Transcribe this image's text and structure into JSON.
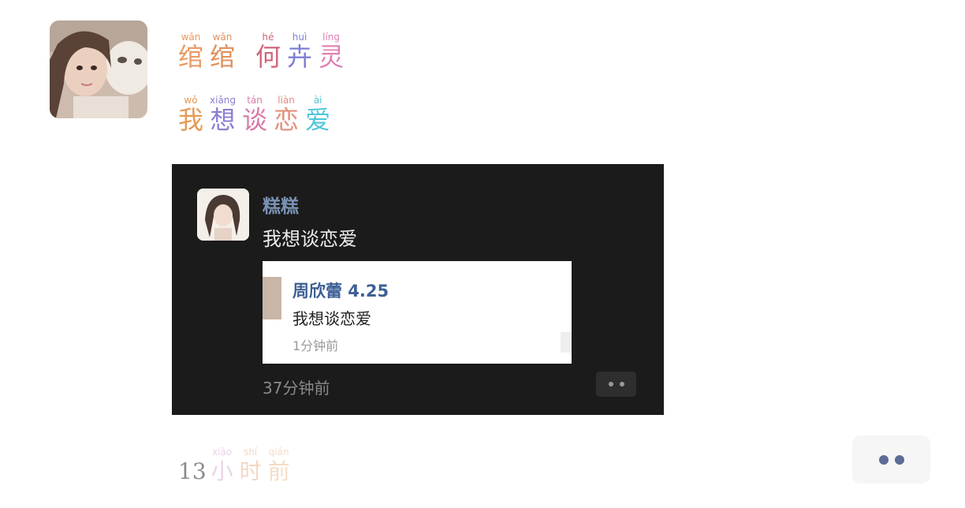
{
  "post": {
    "avatar_icon": "user-avatar-girl-with-cat",
    "line1": [
      {
        "py": "wǎn",
        "hz": "绾",
        "color": "#e89a63"
      },
      {
        "py": "wǎn",
        "hz": "绾",
        "color": "#e0915c"
      },
      {
        "py": "hé",
        "hz": "何",
        "color": "#d0657a"
      },
      {
        "py": "huì",
        "hz": "卉",
        "color": "#7d7fd6"
      },
      {
        "py": "líng",
        "hz": "灵",
        "color": "#e07fb3"
      }
    ],
    "line2": [
      {
        "py": "wǒ",
        "hz": "我",
        "color": "#e59a55"
      },
      {
        "py": "xiǎng",
        "hz": "想",
        "color": "#8a7fd1"
      },
      {
        "py": "tán",
        "hz": "谈",
        "color": "#d77aa9"
      },
      {
        "py": "liàn",
        "hz": "恋",
        "color": "#e58f7b"
      },
      {
        "py": "ài",
        "hz": "爱",
        "color": "#4fc6d8"
      }
    ],
    "time_number": "13",
    "time_chars": [
      {
        "py": "xiǎo",
        "hz": "小",
        "color": "#d39ad0"
      },
      {
        "py": "shí",
        "hz": "时",
        "color": "#e3a882"
      },
      {
        "py": "qián",
        "hz": "前",
        "color": "#e7b37b"
      }
    ]
  },
  "screenshot": {
    "name": "糕糕",
    "message": "我想谈恋爱",
    "quote": {
      "name": "周欣蕾 4.25",
      "message": "我想谈恋爱",
      "time": "1分钟前"
    },
    "time": "37分钟前"
  },
  "actions": {
    "more_icon": "more-dots-icon"
  }
}
